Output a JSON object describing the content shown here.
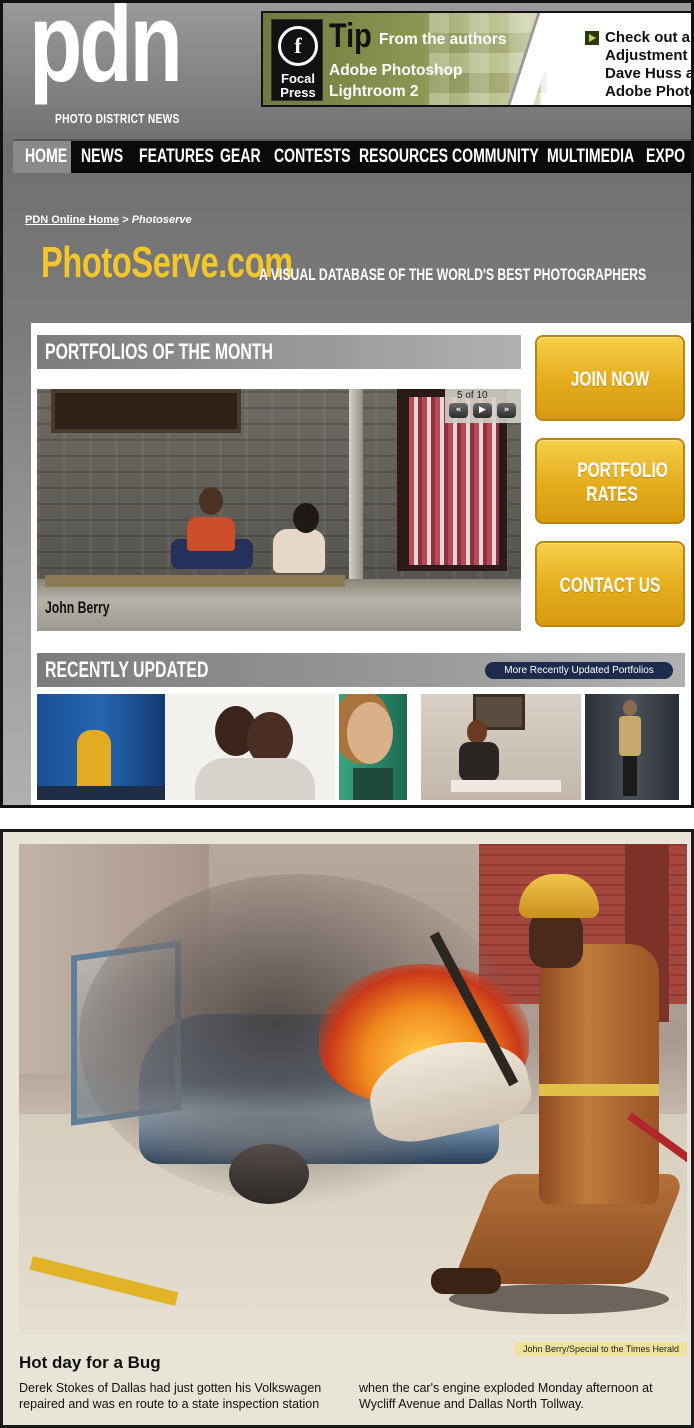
{
  "header": {
    "logo": "pdn",
    "logo_tagline": "PHOTO DISTRICT NEWS"
  },
  "banner": {
    "publisher_line1": "Focal",
    "publisher_line2": "Press",
    "publisher_glyph": "f",
    "tip_title": "Tip",
    "tip_from": "From the authors",
    "tip_line2": "Adobe Photoshop",
    "tip_line3": "Lightroom 2",
    "promo_lines": [
      "Check out a n",
      "Adjustment T",
      "Dave Huss an",
      "Adobe Photo"
    ],
    "accent_color": "#8c9652"
  },
  "nav": {
    "items": [
      "HOME",
      "NEWS",
      "FEATURES",
      "GEAR",
      "CONTESTS",
      "RESOURCES",
      "COMMUNITY",
      "MULTIMEDIA",
      "EXPO"
    ],
    "active": "HOME"
  },
  "breadcrumb": {
    "home": "PDN Online Home",
    "separator": ">",
    "current": "Photoserve"
  },
  "photoserve": {
    "logo": "PhotoServe.com",
    "tagline": "A VISUAL DATABASE OF THE WORLD'S BEST PHOTOGRAPHERS",
    "brand_color": "#f3c62b"
  },
  "portfolios": {
    "title": "PORTFOLIOS OF THE MONTH",
    "counter": "5 of 10",
    "controls": [
      "«",
      "▶",
      "»"
    ],
    "caption": "John Berry"
  },
  "cta_buttons": [
    {
      "label": "JOIN NOW"
    },
    {
      "label": "PORTFOLIO RATES"
    },
    {
      "label": "CONTACT US"
    }
  ],
  "recently_updated": {
    "title": "RECENTLY UPDATED",
    "more_link": "More Recently Updated Portfolios",
    "thumbnails": [
      "blue-doorway-photo",
      "couple-portrait-photo",
      "woman-portrait-photo",
      "woman-reading-photo",
      "fashion-model-photo"
    ]
  },
  "clipping": {
    "credit": "John Berry/Special to the Times Herald",
    "headline": "Hot day for a Bug",
    "col1": [
      "Derek Stokes of Dallas had just gotten his Volkswagen",
      "repaired and was en route to a state inspection station"
    ],
    "col2": [
      "when the car's engine exploded Monday afternoon at",
      "Wycliff Avenue and Dallas North Tollway."
    ]
  }
}
